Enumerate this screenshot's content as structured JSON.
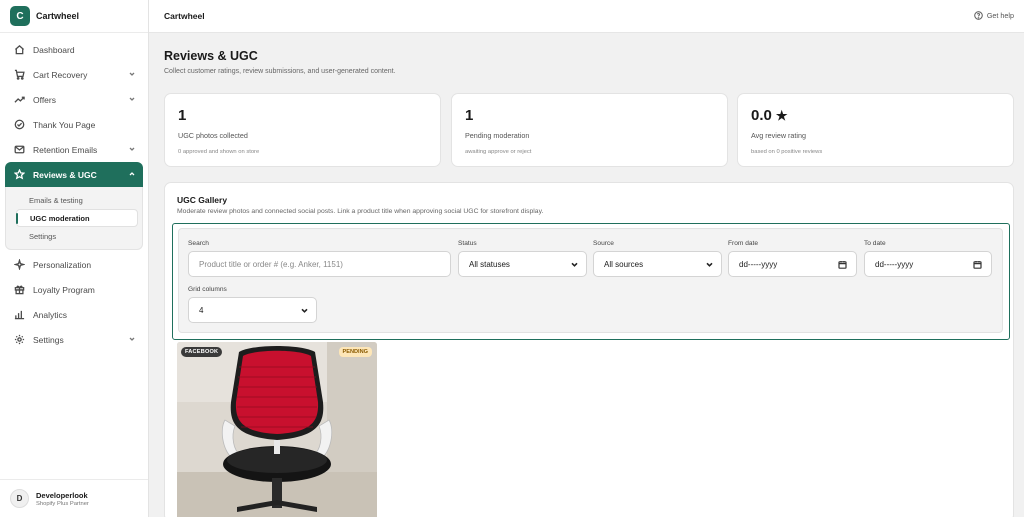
{
  "app": {
    "logo_letter": "C",
    "name": "Cartwheel"
  },
  "sidebar": {
    "items": [
      {
        "label": "Dashboard",
        "icon": "home-icon"
      },
      {
        "label": "Cart Recovery",
        "icon": "cart-icon"
      },
      {
        "label": "Offers",
        "icon": "trend-icon"
      },
      {
        "label": "Thank You Page",
        "icon": "check-circle-icon"
      },
      {
        "label": "Retention Emails",
        "icon": "mail-icon"
      },
      {
        "label": "Reviews & UGC",
        "icon": "star-icon"
      },
      {
        "label": "Personalization",
        "icon": "sparkle-icon"
      },
      {
        "label": "Loyalty Program",
        "icon": "gift-icon"
      },
      {
        "label": "Analytics",
        "icon": "bar-chart-icon"
      },
      {
        "label": "Settings",
        "icon": "gear-icon"
      }
    ],
    "subitems": [
      "Emails & testing",
      "UGC moderation",
      "Settings"
    ],
    "user": {
      "initial": "D",
      "name": "Developerlook",
      "role": "Shopify Plus Partner"
    }
  },
  "topbar": {
    "title": "Cartwheel",
    "help": "Get help"
  },
  "page": {
    "title": "Reviews & UGC",
    "subtitle": "Collect customer ratings, review submissions, and user-generated content."
  },
  "stats": [
    {
      "value": "1",
      "label": "UGC photos collected",
      "note": "0 approved and shown on store"
    },
    {
      "value": "1",
      "label": "Pending moderation",
      "note": "awaiting approve or reject"
    },
    {
      "value": "0.0",
      "star": "★",
      "label": "Avg review rating",
      "note": "based on 0 positive reviews"
    }
  ],
  "gallery": {
    "title": "UGC Gallery",
    "subtitle": "Moderate review photos and connected social posts. Link a product title when approving social UGC for storefront display.",
    "filters": {
      "search_label": "Search",
      "search_placeholder": "Product title or order # (e.g. Anker, 1151)",
      "status_label": "Status",
      "status_value": "All statuses",
      "source_label": "Source",
      "source_value": "All sources",
      "from_label": "From date",
      "from_value": "dd-----yyyy",
      "to_label": "To date",
      "to_value": "dd-----yyyy",
      "grid_label": "Grid columns",
      "grid_value": "4"
    },
    "items": [
      {
        "source": "FACEBOOK",
        "status": "PENDING"
      }
    ]
  }
}
